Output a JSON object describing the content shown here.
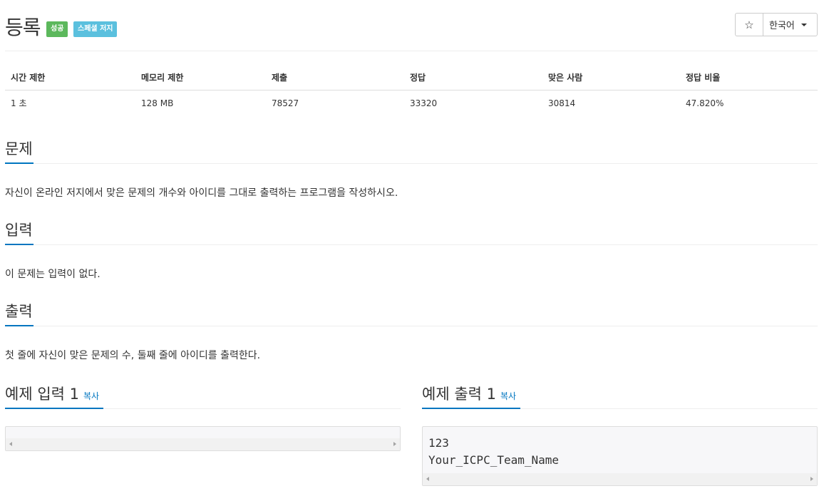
{
  "header": {
    "title": "등록",
    "badges": [
      "성공",
      "스페셜 저지"
    ],
    "star_icon": "☆",
    "language": "한국어"
  },
  "stats": {
    "headers": [
      "시간 제한",
      "메모리 제한",
      "제출",
      "정답",
      "맞은 사람",
      "정답 비율"
    ],
    "values": [
      "1 초",
      "128 MB",
      "78527",
      "33320",
      "30814",
      "47.820%"
    ]
  },
  "sections": {
    "problem": {
      "title": "문제",
      "text": "자신이 온라인 저지에서 맞은 문제의 개수와 아이디를 그대로 출력하는 프로그램을 작성하시오."
    },
    "input": {
      "title": "입력",
      "text": "이 문제는 입력이 없다."
    },
    "output": {
      "title": "출력",
      "text": "첫 줄에 자신이 맞은 문제의 수, 둘째 줄에 아이디를 출력한다."
    }
  },
  "samples": {
    "input": {
      "title": "예제 입력 1",
      "copy": "복사",
      "content": ""
    },
    "output": {
      "title": "예제 출력 1",
      "copy": "복사",
      "content": "123\nYour_ICPC_Team_Name"
    }
  },
  "colors": {
    "success": "#5cb85c",
    "info": "#5bc0de",
    "accent": "#0076c0"
  }
}
